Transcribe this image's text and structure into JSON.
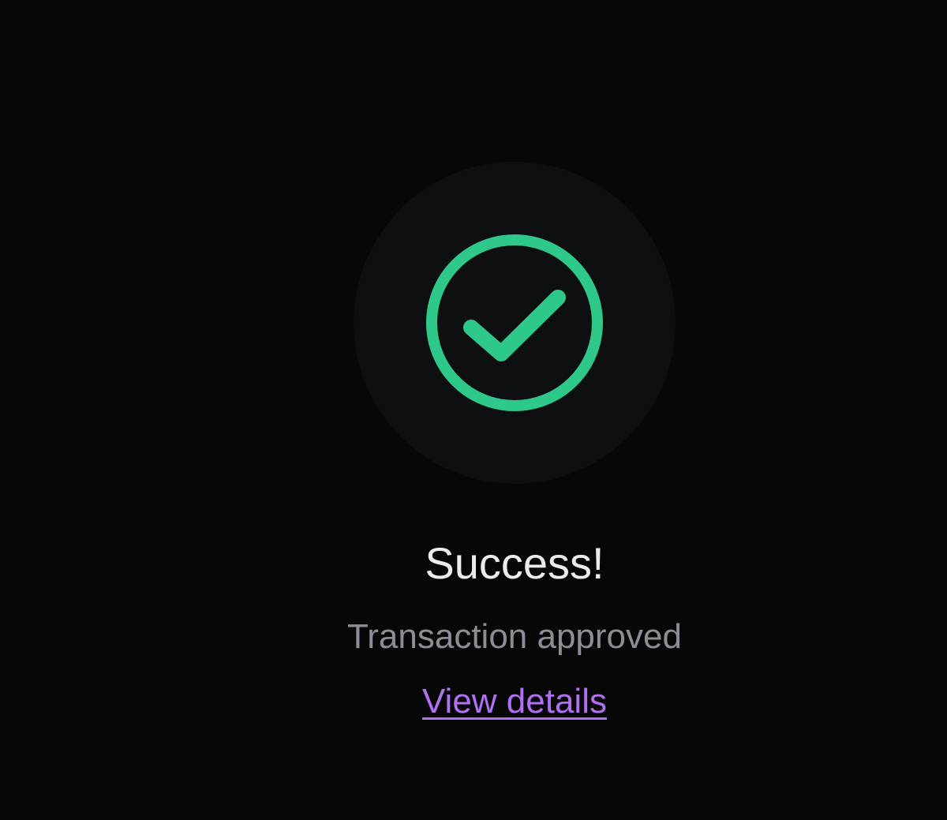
{
  "status": {
    "icon": "check-circle-icon",
    "title": "Success!",
    "message": "Transaction approved",
    "link_label": "View details"
  },
  "colors": {
    "background": "#070708",
    "icon_backdrop": "#0e0f10",
    "success_green": "#2ec98a",
    "title_text": "#ececf0",
    "subtitle_text": "#8c8e96",
    "link": "#b070f2"
  }
}
